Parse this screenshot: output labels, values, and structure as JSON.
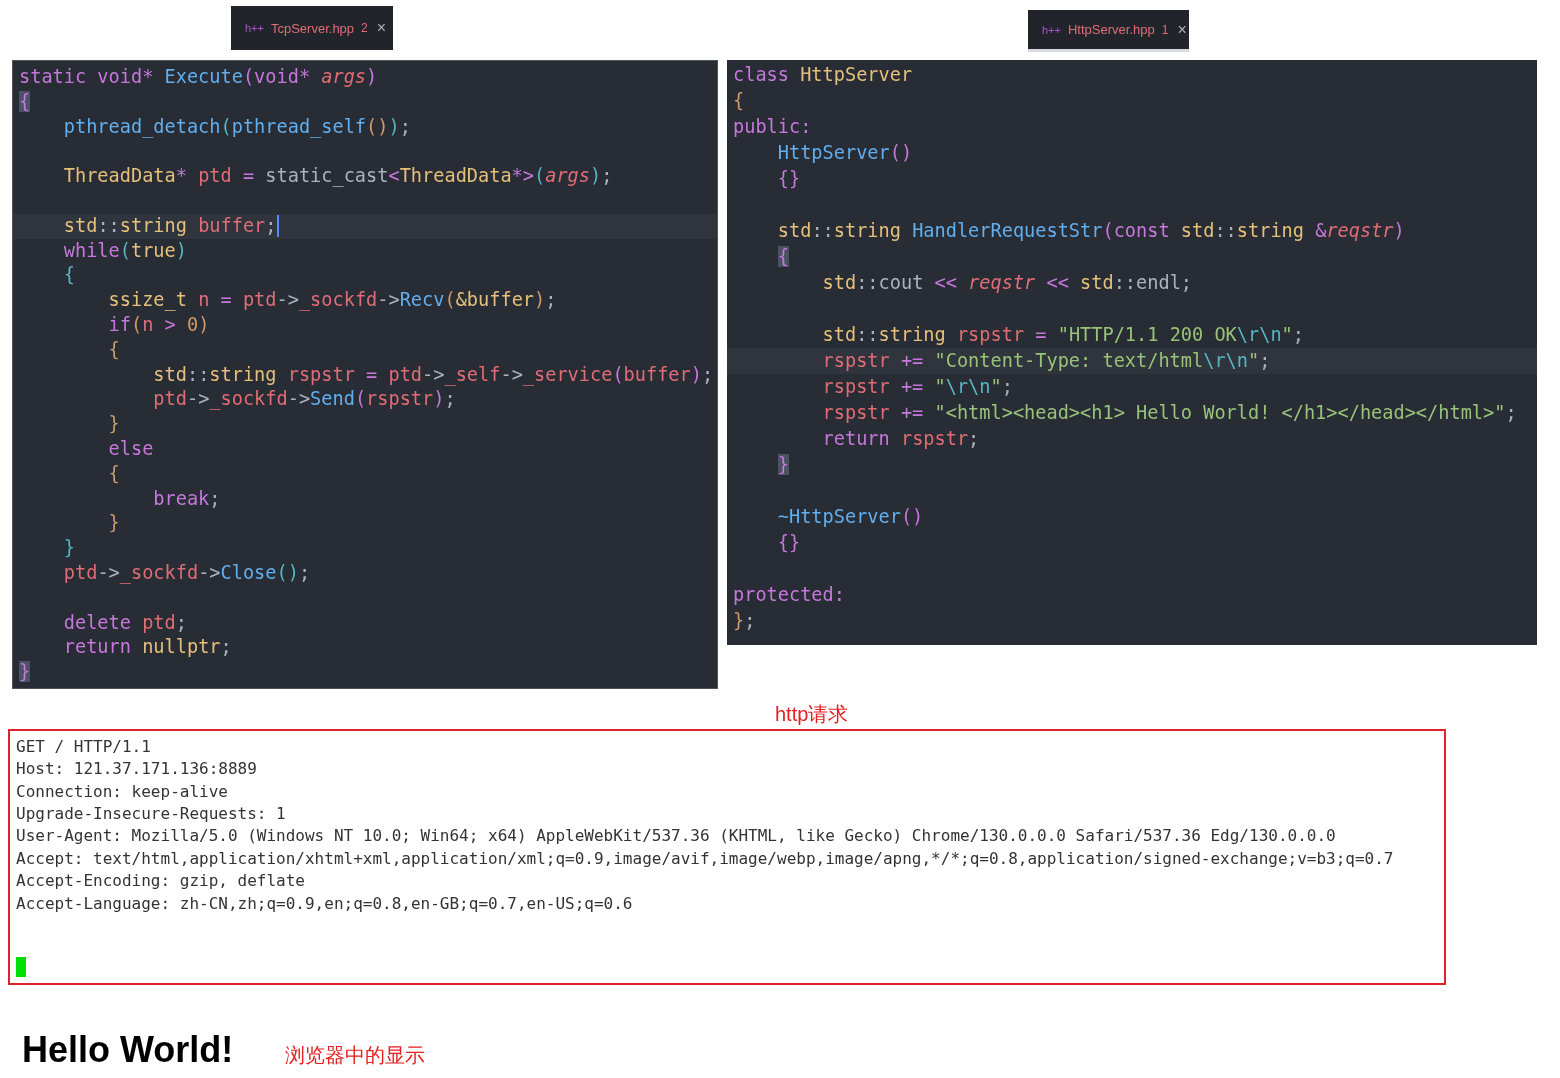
{
  "editors": [
    {
      "tab": {
        "icon": "h++",
        "label": "TcpServer.hpp",
        "badge": "2",
        "close": "×",
        "selected": false
      },
      "lines": [
        {
          "current": false,
          "tokens": [
            {
              "text": "static void* ",
              "kind": "kw"
            },
            {
              "text": "Execute",
              "kind": "fn"
            },
            {
              "text": "(",
              "kind": "b3"
            },
            {
              "text": "void* ",
              "kind": "kw"
            },
            {
              "text": "args",
              "kind": "par"
            },
            {
              "text": ")",
              "kind": "b3"
            }
          ]
        },
        {
          "current": false,
          "tokens": [
            {
              "text": "{",
              "kind": "m"
            }
          ]
        },
        {
          "current": false,
          "tokens": [
            {
              "text": "    pthread_detach",
              "kind": "fn"
            },
            {
              "text": "(",
              "kind": "b2"
            },
            {
              "text": "pthread_self",
              "kind": "fn"
            },
            {
              "text": "()",
              "kind": "b1"
            },
            {
              "text": ")",
              "kind": "b2"
            },
            {
              "text": ";",
              "kind": "p"
            }
          ]
        },
        {
          "current": false
        },
        {
          "current": false,
          "tokens": [
            {
              "text": "    ThreadData",
              "kind": "ty"
            },
            {
              "text": "* ",
              "kind": "kw"
            },
            {
              "text": "ptd",
              "kind": "var"
            },
            {
              "text": " = ",
              "kind": "kw"
            },
            {
              "text": "static_cast",
              "kind": "p"
            },
            {
              "text": "<",
              "kind": "kw"
            },
            {
              "text": "ThreadData",
              "kind": "ty"
            },
            {
              "text": "*>",
              "kind": "kw"
            },
            {
              "text": "(",
              "kind": "b2"
            },
            {
              "text": "args",
              "kind": "par"
            },
            {
              "text": ")",
              "kind": "b2"
            },
            {
              "text": ";",
              "kind": "p"
            }
          ]
        },
        {
          "current": false
        },
        {
          "current": true,
          "caret": true,
          "tokens": [
            {
              "text": "    std",
              "kind": "ty"
            },
            {
              "text": "::",
              "kind": "p"
            },
            {
              "text": "string ",
              "kind": "ty"
            },
            {
              "text": "buffer",
              "kind": "var"
            },
            {
              "text": ";",
              "kind": "p"
            }
          ]
        },
        {
          "current": false,
          "tokens": [
            {
              "text": "    while",
              "kind": "kw"
            },
            {
              "text": "(",
              "kind": "b2"
            },
            {
              "text": "true",
              "kind": "ty"
            },
            {
              "text": ")",
              "kind": "b2"
            }
          ]
        },
        {
          "current": false,
          "tokens": [
            {
              "text": "    {",
              "kind": "b2"
            }
          ]
        },
        {
          "current": false,
          "tokens": [
            {
              "text": "        ssize_t ",
              "kind": "ty"
            },
            {
              "text": "n",
              "kind": "var"
            },
            {
              "text": " = ",
              "kind": "kw"
            },
            {
              "text": "ptd",
              "kind": "var"
            },
            {
              "text": "->",
              "kind": "p"
            },
            {
              "text": "_sockfd",
              "kind": "var"
            },
            {
              "text": "->",
              "kind": "p"
            },
            {
              "text": "Recv",
              "kind": "fn"
            },
            {
              "text": "(",
              "kind": "b1"
            },
            {
              "text": "&buffer",
              "kind": "ty"
            },
            {
              "text": ")",
              "kind": "b1"
            },
            {
              "text": ";",
              "kind": "p"
            }
          ]
        },
        {
          "current": false,
          "tokens": [
            {
              "text": "        if",
              "kind": "kw"
            },
            {
              "text": "(",
              "kind": "b1"
            },
            {
              "text": "n",
              "kind": "var"
            },
            {
              "text": " > ",
              "kind": "kw"
            },
            {
              "text": "0",
              "kind": "num"
            },
            {
              "text": ")",
              "kind": "b1"
            }
          ]
        },
        {
          "current": false,
          "tokens": [
            {
              "text": "        {",
              "kind": "b1"
            }
          ]
        },
        {
          "current": false,
          "tokens": [
            {
              "text": "            std",
              "kind": "ty"
            },
            {
              "text": "::",
              "kind": "p"
            },
            {
              "text": "string ",
              "kind": "ty"
            },
            {
              "text": "rspstr",
              "kind": "var"
            },
            {
              "text": " = ",
              "kind": "kw"
            },
            {
              "text": "ptd",
              "kind": "var"
            },
            {
              "text": "->",
              "kind": "p"
            },
            {
              "text": "_self",
              "kind": "var"
            },
            {
              "text": "->",
              "kind": "p"
            },
            {
              "text": "_service",
              "kind": "var"
            },
            {
              "text": "(",
              "kind": "b3"
            },
            {
              "text": "buffer",
              "kind": "var"
            },
            {
              "text": ")",
              "kind": "b3"
            },
            {
              "text": ";",
              "kind": "p"
            }
          ]
        },
        {
          "current": false,
          "tokens": [
            {
              "text": "            ptd",
              "kind": "var"
            },
            {
              "text": "->",
              "kind": "p"
            },
            {
              "text": "_sockfd",
              "kind": "var"
            },
            {
              "text": "->",
              "kind": "p"
            },
            {
              "text": "Send",
              "kind": "fn"
            },
            {
              "text": "(",
              "kind": "b3"
            },
            {
              "text": "rspstr",
              "kind": "var"
            },
            {
              "text": ")",
              "kind": "b3"
            },
            {
              "text": ";",
              "kind": "p"
            }
          ]
        },
        {
          "current": false,
          "tokens": [
            {
              "text": "        }",
              "kind": "b1"
            }
          ]
        },
        {
          "current": false,
          "tokens": [
            {
              "text": "        else",
              "kind": "kw"
            }
          ]
        },
        {
          "current": false,
          "tokens": [
            {
              "text": "        {",
              "kind": "b1"
            }
          ]
        },
        {
          "current": false,
          "tokens": [
            {
              "text": "            break",
              "kind": "kw"
            },
            {
              "text": ";",
              "kind": "p"
            }
          ]
        },
        {
          "current": false,
          "tokens": [
            {
              "text": "        }",
              "kind": "b1"
            }
          ]
        },
        {
          "current": false,
          "tokens": [
            {
              "text": "    }",
              "kind": "b2"
            }
          ]
        },
        {
          "current": false,
          "tokens": [
            {
              "text": "    ptd",
              "kind": "var"
            },
            {
              "text": "->",
              "kind": "p"
            },
            {
              "text": "_sockfd",
              "kind": "var"
            },
            {
              "text": "->",
              "kind": "p"
            },
            {
              "text": "Close",
              "kind": "fn"
            },
            {
              "text": "()",
              "kind": "b2"
            },
            {
              "text": ";",
              "kind": "p"
            }
          ]
        },
        {
          "current": false
        },
        {
          "current": false,
          "tokens": [
            {
              "text": "    delete ",
              "kind": "kw"
            },
            {
              "text": "ptd",
              "kind": "var"
            },
            {
              "text": ";",
              "kind": "p"
            }
          ]
        },
        {
          "current": false,
          "tokens": [
            {
              "text": "    return ",
              "kind": "kw"
            },
            {
              "text": "nullptr",
              "kind": "ty"
            },
            {
              "text": ";",
              "kind": "p"
            }
          ]
        },
        {
          "current": false,
          "tokens": [
            {
              "text": "}",
              "kind": "m"
            }
          ]
        }
      ]
    },
    {
      "tab": {
        "icon": "h++",
        "label": "HttpServer.hpp",
        "badge": "1",
        "close": "×",
        "selected": true
      },
      "lines": [
        {
          "current": false,
          "tokens": [
            {
              "text": "class ",
              "kind": "kw"
            },
            {
              "text": "HttpServer",
              "kind": "ty"
            }
          ]
        },
        {
          "current": false,
          "tokens": [
            {
              "text": "{",
              "kind": "b1"
            }
          ]
        },
        {
          "current": false,
          "tokens": [
            {
              "text": "public:",
              "kind": "kw"
            }
          ]
        },
        {
          "current": false,
          "tokens": [
            {
              "text": "    HttpServer",
              "kind": "fn"
            },
            {
              "text": "()",
              "kind": "b3"
            }
          ]
        },
        {
          "current": false,
          "tokens": [
            {
              "text": "    {}",
              "kind": "b3"
            }
          ]
        },
        {
          "current": false
        },
        {
          "current": false,
          "tokens": [
            {
              "text": "    std",
              "kind": "ty"
            },
            {
              "text": "::",
              "kind": "p"
            },
            {
              "text": "string ",
              "kind": "ty"
            },
            {
              "text": "HandlerRequestStr",
              "kind": "fn"
            },
            {
              "text": "(",
              "kind": "b3"
            },
            {
              "text": "const ",
              "kind": "kw"
            },
            {
              "text": "std",
              "kind": "ty"
            },
            {
              "text": "::",
              "kind": "p"
            },
            {
              "text": "string ",
              "kind": "ty"
            },
            {
              "text": "&",
              "kind": "kw"
            },
            {
              "text": "reqstr",
              "kind": "par"
            },
            {
              "text": ")",
              "kind": "b3"
            }
          ]
        },
        {
          "current": false,
          "tokens": [
            {
              "text": "    {",
              "kind": "m"
            }
          ]
        },
        {
          "current": false,
          "tokens": [
            {
              "text": "        std",
              "kind": "ty"
            },
            {
              "text": "::",
              "kind": "p"
            },
            {
              "text": "cout ",
              "kind": "p"
            },
            {
              "text": "<< ",
              "kind": "kw"
            },
            {
              "text": "reqstr",
              "kind": "par"
            },
            {
              "text": " << ",
              "kind": "kw"
            },
            {
              "text": "std",
              "kind": "ty"
            },
            {
              "text": "::",
              "kind": "p"
            },
            {
              "text": "endl",
              "kind": "p"
            },
            {
              "text": ";",
              "kind": "p"
            }
          ]
        },
        {
          "current": false
        },
        {
          "current": false,
          "tokens": [
            {
              "text": "        std",
              "kind": "ty"
            },
            {
              "text": "::",
              "kind": "p"
            },
            {
              "text": "string ",
              "kind": "ty"
            },
            {
              "text": "rspstr",
              "kind": "var"
            },
            {
              "text": " = ",
              "kind": "kw"
            },
            {
              "text": "\"HTTP/1.1 200 OK",
              "kind": "str"
            },
            {
              "text": "\\r\\n",
              "kind": "esc"
            },
            {
              "text": "\"",
              "kind": "str"
            },
            {
              "text": ";",
              "kind": "p"
            }
          ]
        },
        {
          "current": true,
          "tokens": [
            {
              "text": "        rspstr",
              "kind": "var"
            },
            {
              "text": " += ",
              "kind": "kw"
            },
            {
              "text": "\"Content-Type: text/html",
              "kind": "str"
            },
            {
              "text": "\\r\\n",
              "kind": "esc"
            },
            {
              "text": "\"",
              "kind": "str"
            },
            {
              "text": ";",
              "kind": "p"
            }
          ]
        },
        {
          "current": false,
          "tokens": [
            {
              "text": "        rspstr",
              "kind": "var"
            },
            {
              "text": " += ",
              "kind": "kw"
            },
            {
              "text": "\"",
              "kind": "str"
            },
            {
              "text": "\\r\\n",
              "kind": "esc"
            },
            {
              "text": "\"",
              "kind": "str"
            },
            {
              "text": ";",
              "kind": "p"
            }
          ]
        },
        {
          "current": false,
          "tokens": [
            {
              "text": "        rspstr",
              "kind": "var"
            },
            {
              "text": " += ",
              "kind": "kw"
            },
            {
              "text": "\"<html><head><h1> Hello World! </h1></head></html>\"",
              "kind": "str"
            },
            {
              "text": ";",
              "kind": "p"
            }
          ]
        },
        {
          "current": false,
          "tokens": [
            {
              "text": "        return ",
              "kind": "kw"
            },
            {
              "text": "rspstr",
              "kind": "var"
            },
            {
              "text": ";",
              "kind": "p"
            }
          ]
        },
        {
          "current": false,
          "tokens": [
            {
              "text": "    }",
              "kind": "m"
            }
          ]
        },
        {
          "current": false
        },
        {
          "current": false,
          "tokens": [
            {
              "text": "    ~HttpServer",
              "kind": "fn"
            },
            {
              "text": "()",
              "kind": "b3"
            }
          ]
        },
        {
          "current": false,
          "tokens": [
            {
              "text": "    {}",
              "kind": "b3"
            }
          ]
        },
        {
          "current": false
        },
        {
          "current": false,
          "tokens": [
            {
              "text": "protected:",
              "kind": "kw"
            }
          ]
        },
        {
          "current": false,
          "tokens": [
            {
              "text": "}",
              "kind": "b1"
            },
            {
              "text": ";",
              "kind": "p"
            }
          ]
        }
      ]
    }
  ],
  "request_label": "http请求",
  "terminal": {
    "lines": [
      "GET / HTTP/1.1",
      "Host: 121.37.171.136:8889",
      "Connection: keep-alive",
      "Upgrade-Insecure-Requests: 1",
      "User-Agent: Mozilla/5.0 (Windows NT 10.0; Win64; x64) AppleWebKit/537.36 (KHTML, like Gecko) Chrome/130.0.0.0 Safari/537.36 Edg/130.0.0.0",
      "Accept: text/html,application/xhtml+xml,application/xml;q=0.9,image/avif,image/webp,image/apng,*/*;q=0.8,application/signed-exchange;v=b3;q=0.7",
      "Accept-Encoding: gzip, deflate",
      "Accept-Language: zh-CN,zh;q=0.9,en;q=0.8,en-GB;q=0.7,en-US;q=0.6"
    ],
    "cursor": true
  },
  "browser": {
    "heading": "Hello World!",
    "caption": "浏览器中的显示"
  }
}
